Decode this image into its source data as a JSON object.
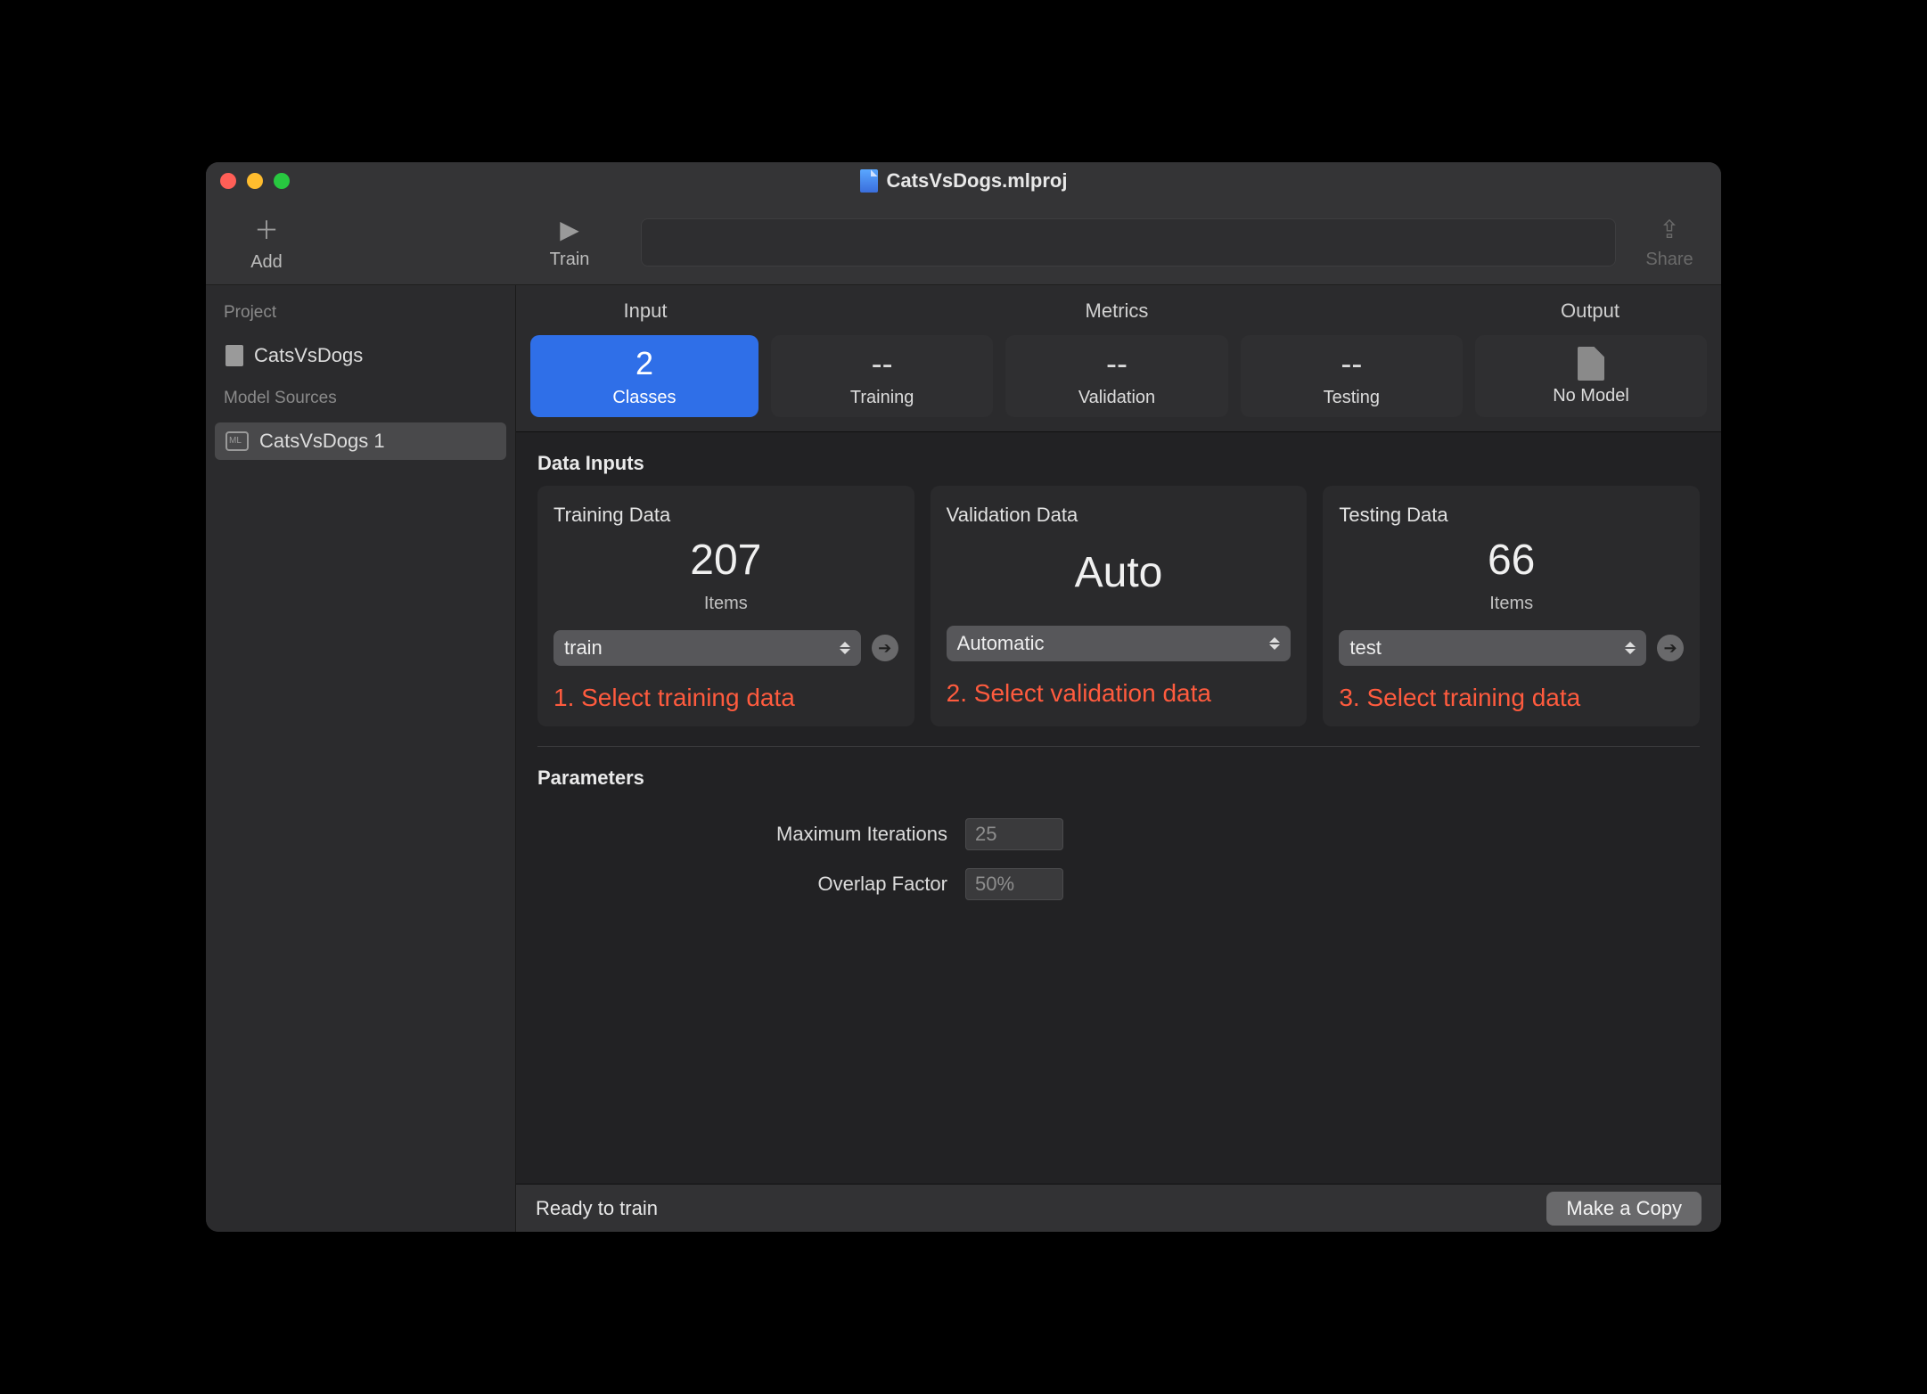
{
  "window": {
    "title": "CatsVsDogs.mlproj"
  },
  "toolbar": {
    "add_label": "Add",
    "train_label": "Train",
    "share_label": "Share"
  },
  "sidebar": {
    "project_heading": "Project",
    "project_name": "CatsVsDogs",
    "sources_heading": "Model Sources",
    "source_name": "CatsVsDogs 1"
  },
  "seg_headers": {
    "input": "Input",
    "metrics": "Metrics",
    "output": "Output"
  },
  "tiles": {
    "input": {
      "value": "2",
      "label": "Classes"
    },
    "training": {
      "value": "--",
      "label": "Training"
    },
    "validation": {
      "value": "--",
      "label": "Validation"
    },
    "testing": {
      "value": "--",
      "label": "Testing"
    },
    "output": {
      "label": "No Model"
    }
  },
  "sections": {
    "data_inputs": "Data Inputs",
    "parameters": "Parameters"
  },
  "cards": {
    "training": {
      "title": "Training Data",
      "value": "207",
      "sub": "Items",
      "select": "train",
      "annotation": "1. Select training data"
    },
    "validation": {
      "title": "Validation Data",
      "value": "Auto",
      "select": "Automatic",
      "annotation": "2. Select validation data"
    },
    "testing": {
      "title": "Testing Data",
      "value": "66",
      "sub": "Items",
      "select": "test",
      "annotation": "3. Select training data"
    }
  },
  "params": {
    "max_iter_label": "Maximum Iterations",
    "max_iter_value": "25",
    "overlap_label": "Overlap Factor",
    "overlap_value": "50%"
  },
  "status": {
    "text": "Ready to train",
    "copy_btn": "Make a Copy"
  }
}
